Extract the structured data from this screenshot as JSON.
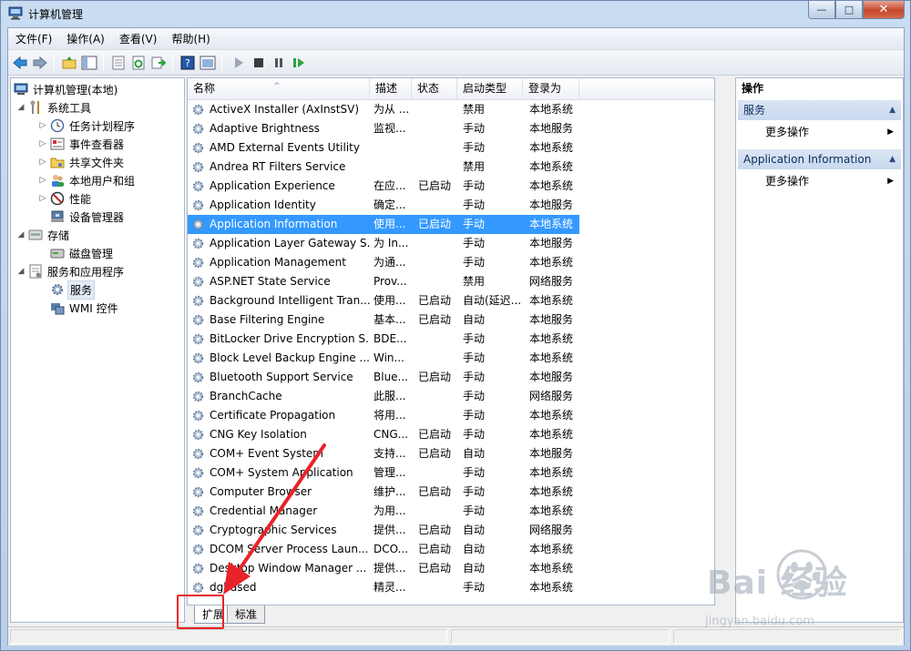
{
  "window": {
    "title": "计算机管理",
    "minimize": "—",
    "maximize": "□",
    "close": "✕"
  },
  "menu": [
    "文件(F)",
    "操作(A)",
    "查看(V)",
    "帮助(H)"
  ],
  "tree": {
    "root": "计算机管理(本地)",
    "system_tools": "系统工具",
    "task_scheduler": "任务计划程序",
    "event_viewer": "事件查看器",
    "shared_folders": "共享文件夹",
    "local_users": "本地用户和组",
    "performance": "性能",
    "device_manager": "设备管理器",
    "storage": "存储",
    "disk_management": "磁盘管理",
    "services_apps": "服务和应用程序",
    "services": "服务",
    "wmi": "WMI 控件"
  },
  "list": {
    "columns": [
      "名称",
      "描述",
      "状态",
      "启动类型",
      "登录为"
    ],
    "sort_caret": "^",
    "rows": [
      [
        "ActiveX Installer (AxInstSV)",
        "为从 ...",
        "",
        "禁用",
        "本地系统"
      ],
      [
        "Adaptive Brightness",
        "监视...",
        "",
        "手动",
        "本地服务"
      ],
      [
        "AMD External Events Utility",
        "",
        "",
        "手动",
        "本地系统"
      ],
      [
        "Andrea RT Filters Service",
        "",
        "",
        "禁用",
        "本地系统"
      ],
      [
        "Application Experience",
        "在应...",
        "已启动",
        "手动",
        "本地系统"
      ],
      [
        "Application Identity",
        "确定...",
        "",
        "手动",
        "本地服务"
      ],
      [
        "Application Information",
        "使用...",
        "已启动",
        "手动",
        "本地系统"
      ],
      [
        "Application Layer Gateway S...",
        "为 In...",
        "",
        "手动",
        "本地服务"
      ],
      [
        "Application Management",
        "为通...",
        "",
        "手动",
        "本地系统"
      ],
      [
        "ASP.NET State Service",
        "Prov...",
        "",
        "禁用",
        "网络服务"
      ],
      [
        "Background Intelligent Tran...",
        "使用...",
        "已启动",
        "自动(延迟...",
        "本地系统"
      ],
      [
        "Base Filtering Engine",
        "基本...",
        "已启动",
        "自动",
        "本地服务"
      ],
      [
        "BitLocker Drive Encryption S...",
        "BDE...",
        "",
        "手动",
        "本地系统"
      ],
      [
        "Block Level Backup Engine ...",
        "Win...",
        "",
        "手动",
        "本地系统"
      ],
      [
        "Bluetooth Support Service",
        "Blue...",
        "已启动",
        "手动",
        "本地服务"
      ],
      [
        "BranchCache",
        "此服...",
        "",
        "手动",
        "网络服务"
      ],
      [
        "Certificate Propagation",
        "将用...",
        "",
        "手动",
        "本地系统"
      ],
      [
        "CNG Key Isolation",
        "CNG...",
        "已启动",
        "手动",
        "本地系统"
      ],
      [
        "COM+ Event System",
        "支持...",
        "已启动",
        "自动",
        "本地服务"
      ],
      [
        "COM+ System Application",
        "管理...",
        "",
        "手动",
        "本地系统"
      ],
      [
        "Computer Browser",
        "维护...",
        "已启动",
        "手动",
        "本地系统"
      ],
      [
        "Credential Manager",
        "为用...",
        "",
        "手动",
        "本地系统"
      ],
      [
        "Cryptographic Services",
        "提供...",
        "已启动",
        "自动",
        "网络服务"
      ],
      [
        "DCOM Server Process Laun...",
        "DCO...",
        "已启动",
        "自动",
        "本地系统"
      ],
      [
        "Desktop Window Manager ...",
        "提供...",
        "已启动",
        "自动",
        "本地系统"
      ],
      [
        "dgbased",
        "精灵...",
        "",
        "手动",
        "本地系统"
      ]
    ],
    "selected_index": 6
  },
  "tabs": [
    "扩展",
    "标准"
  ],
  "actions": {
    "title": "操作",
    "section1": "服务",
    "section1_item": "更多操作",
    "section2": "Application Information",
    "section2_item": "更多操作"
  },
  "watermark": {
    "brand": "Bai 经验",
    "url": "jingyan.baidu.com"
  },
  "colors": {
    "selection": "#3399ff",
    "annotation": "#e8232a"
  }
}
